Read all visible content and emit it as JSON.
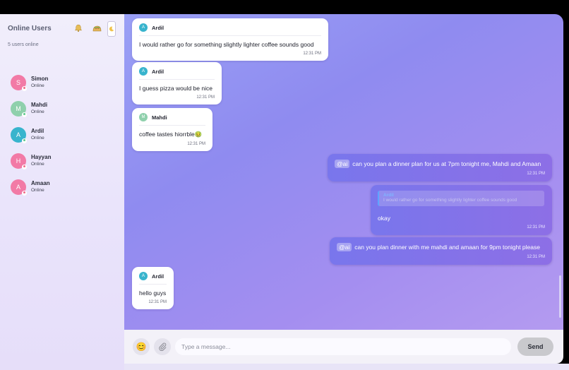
{
  "sidebar": {
    "title": "Online Users",
    "count": "5 users online",
    "icons": {
      "bell": "bell-icon",
      "taco": "taco-icon",
      "theme": "moon-icon"
    },
    "users": [
      {
        "initial": "S",
        "name": "Simon",
        "status": "Online",
        "color": "#f27aa6"
      },
      {
        "initial": "M",
        "name": "Mahdi",
        "status": "Online",
        "color": "#8fd0ac"
      },
      {
        "initial": "A",
        "name": "Ardil",
        "status": "Online",
        "color": "#38b4cd"
      },
      {
        "initial": "H",
        "name": "Hayyan",
        "status": "Online",
        "color": "#f27aa6"
      },
      {
        "initial": "A",
        "name": "Amaan",
        "status": "Online",
        "color": "#f27aa6"
      }
    ]
  },
  "messages": [
    {
      "sender": "Ardil",
      "initial": "A",
      "text": "I would rather go for something slightly lighter coffee sounds good",
      "time": "12:31 PM"
    },
    {
      "sender": "Ardil",
      "initial": "A",
      "text": "I guess pizza would be nice",
      "time": "12:31 PM"
    },
    {
      "sender": "Mahdi",
      "initial": "M",
      "text": "coffee tastes hiorrble🤢",
      "time": "12:31 PM"
    },
    {
      "mention": "@ai",
      "text": "can you plan a dinner plan for us at 7pm tonight me, Mahdi and Amaan",
      "time": "12:31 PM"
    },
    {
      "reply_name": "Ardil",
      "reply_text": "I would rather go for something slightly lighter coffee sounds good",
      "text": "okay",
      "time": "12:31 PM"
    },
    {
      "mention": "@ai",
      "text": "can you plan dinner with me mahdi and amaan for 9pm tonight please",
      "time": "12:31 PM"
    },
    {
      "sender": "Ardil",
      "initial": "A",
      "text": "hello guys",
      "time": "12:31 PM"
    }
  ],
  "composer": {
    "placeholder": "Type a message...",
    "emoji": "😊",
    "attach": "📎",
    "send_label": "Send"
  },
  "colors": {
    "ardil": "#38b4cd",
    "mahdi": "#8fd0ac"
  }
}
